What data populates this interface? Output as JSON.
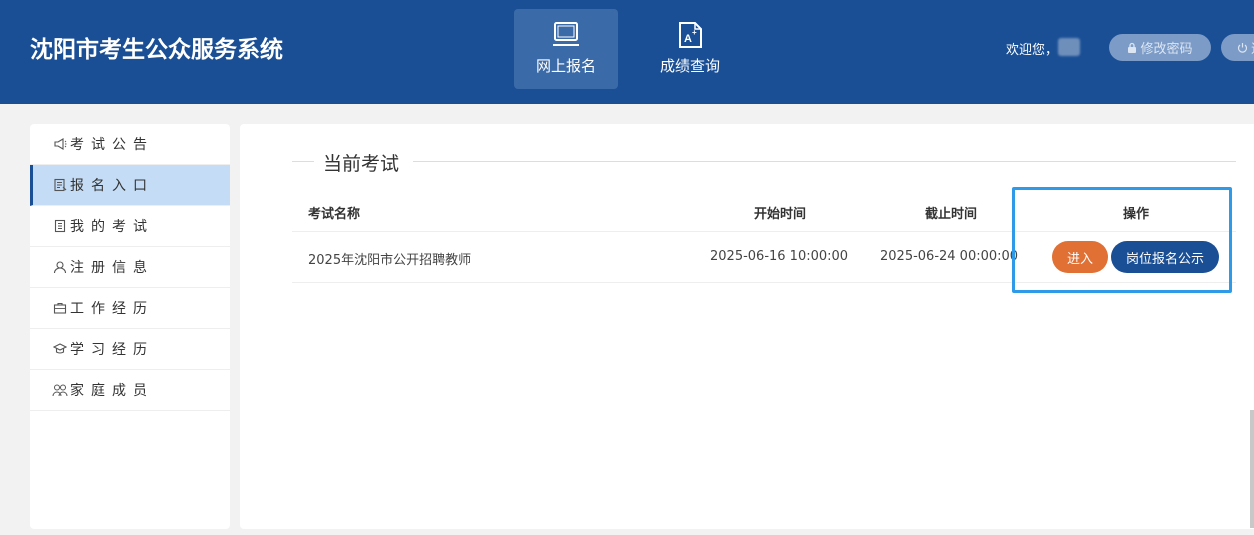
{
  "header": {
    "title": "沈阳市考生公众服务系统",
    "nav": [
      {
        "label": "网上报名",
        "icon": "laptop-icon",
        "active": true
      },
      {
        "label": "成绩查询",
        "icon": "grade-document-icon",
        "active": false
      }
    ],
    "welcome": "欢迎您，",
    "change_password": "修改密码",
    "logout_partial": "退"
  },
  "sidebar": {
    "items": [
      {
        "label": "考试公告",
        "icon": "megaphone-icon"
      },
      {
        "label": "报名入口",
        "icon": "form-icon",
        "active": true
      },
      {
        "label": "我的考试",
        "icon": "exam-book-icon"
      },
      {
        "label": "注册信息",
        "icon": "user-icon"
      },
      {
        "label": "工作经历",
        "icon": "briefcase-icon"
      },
      {
        "label": "学习经历",
        "icon": "graduation-cap-icon"
      },
      {
        "label": "家庭成员",
        "icon": "family-icon"
      }
    ]
  },
  "main": {
    "section_title": "当前考试",
    "table": {
      "headers": [
        "考试名称",
        "开始时间",
        "截止时间",
        "操作"
      ],
      "rows": [
        {
          "name": "2025年沈阳市公开招聘教师",
          "start": "2025-06-16 10:00:00",
          "end": "2025-06-24 00:00:00",
          "actions": {
            "enter": "进入",
            "announce": "岗位报名公示"
          }
        }
      ]
    }
  },
  "colors": {
    "header_bg": "#1a4f95",
    "enter_button": "#e07034",
    "announce_button": "#1a4f95",
    "highlight": "#2e9ae8",
    "sidebar_active": "#c4dcf5"
  }
}
